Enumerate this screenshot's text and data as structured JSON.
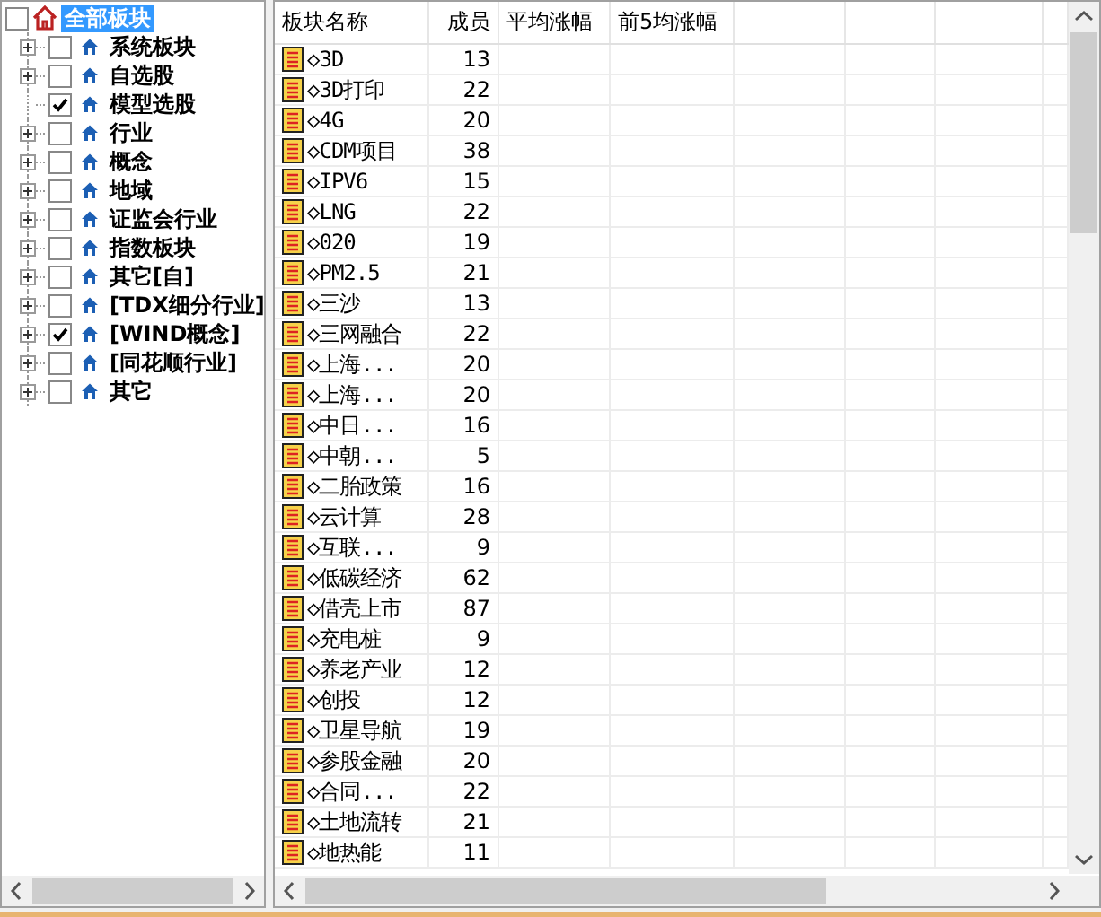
{
  "tree": {
    "label": "全部板块",
    "checked": false,
    "selected": true,
    "children": [
      {
        "label": "系统板块",
        "checked": false,
        "expandable": true
      },
      {
        "label": "自选股",
        "checked": false,
        "expandable": true
      },
      {
        "label": "模型选股",
        "checked": true,
        "expandable": false
      },
      {
        "label": "行业",
        "checked": false,
        "expandable": true
      },
      {
        "label": "概念",
        "checked": false,
        "expandable": true
      },
      {
        "label": "地域",
        "checked": false,
        "expandable": true
      },
      {
        "label": "证监会行业",
        "checked": false,
        "expandable": true
      },
      {
        "label": "指数板块",
        "checked": false,
        "expandable": true
      },
      {
        "label": "其它[自]",
        "checked": false,
        "expandable": true
      },
      {
        "label": "[TDX细分行业]",
        "checked": false,
        "expandable": true
      },
      {
        "label": "[WIND概念]",
        "checked": true,
        "expandable": true
      },
      {
        "label": "[同花顺行业]",
        "checked": false,
        "expandable": true
      },
      {
        "label": "其它",
        "checked": false,
        "expandable": true
      }
    ]
  },
  "table": {
    "columns": [
      "板块名称",
      "成员",
      "平均涨幅",
      "前5均涨幅"
    ],
    "rows": [
      {
        "name": "◇3D",
        "members": "13"
      },
      {
        "name": "◇3D打印",
        "members": "22"
      },
      {
        "name": "◇4G",
        "members": "20"
      },
      {
        "name": "◇CDM项目",
        "members": "38"
      },
      {
        "name": "◇IPV6",
        "members": "15"
      },
      {
        "name": "◇LNG",
        "members": "22"
      },
      {
        "name": "◇020",
        "members": "19"
      },
      {
        "name": "◇PM2.5",
        "members": "21"
      },
      {
        "name": "◇三沙",
        "members": "13"
      },
      {
        "name": "◇三网融合",
        "members": "22"
      },
      {
        "name": "◇上海...",
        "members": "20"
      },
      {
        "name": "◇上海...",
        "members": "20"
      },
      {
        "name": "◇中日...",
        "members": "16"
      },
      {
        "name": "◇中朝...",
        "members": "5"
      },
      {
        "name": "◇二胎政策",
        "members": "16"
      },
      {
        "name": "◇云计算",
        "members": "28"
      },
      {
        "name": "◇互联...",
        "members": "9"
      },
      {
        "name": "◇低碳经济",
        "members": "62"
      },
      {
        "name": "◇借壳上市",
        "members": "87"
      },
      {
        "name": "◇充电桩",
        "members": "9"
      },
      {
        "name": "◇养老产业",
        "members": "12"
      },
      {
        "name": "◇创投",
        "members": "12"
      },
      {
        "name": "◇卫星导航",
        "members": "19"
      },
      {
        "name": "◇参股金融",
        "members": "20"
      },
      {
        "name": "◇合同...",
        "members": "22"
      },
      {
        "name": "◇土地流转",
        "members": "21"
      },
      {
        "name": "◇地热能",
        "members": "11"
      }
    ]
  }
}
